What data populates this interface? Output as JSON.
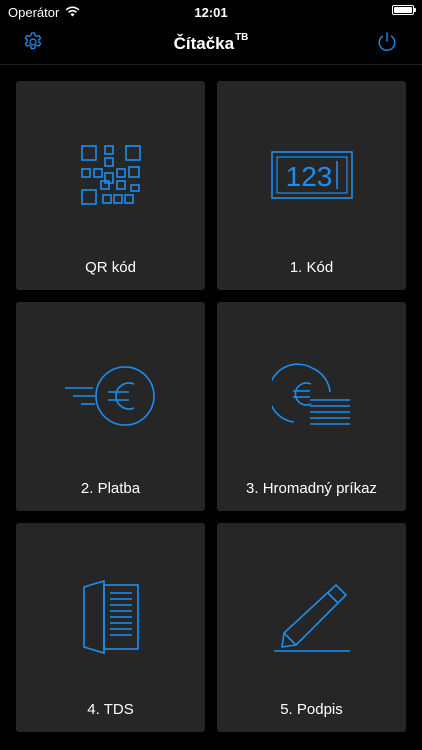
{
  "status_bar": {
    "carrier": "Operátor",
    "time": "12:01"
  },
  "nav": {
    "title": "Čítačka",
    "title_sup": "TB",
    "settings_icon": "gear-icon",
    "power_icon": "power-icon"
  },
  "colors": {
    "accent": "#1c8ef0",
    "tile_bg": "#262626",
    "background": "#000000"
  },
  "tiles": [
    {
      "label": "QR kód",
      "icon": "qr-code-icon"
    },
    {
      "label": "1. Kód",
      "icon": "code-display-icon",
      "display_text": "123"
    },
    {
      "label": "2. Platba",
      "icon": "euro-payment-icon"
    },
    {
      "label": "3. Hromadný príkaz",
      "icon": "euro-batch-icon"
    },
    {
      "label": "4. TDS",
      "icon": "document-icon"
    },
    {
      "label": "5. Podpis",
      "icon": "pencil-signature-icon"
    }
  ]
}
